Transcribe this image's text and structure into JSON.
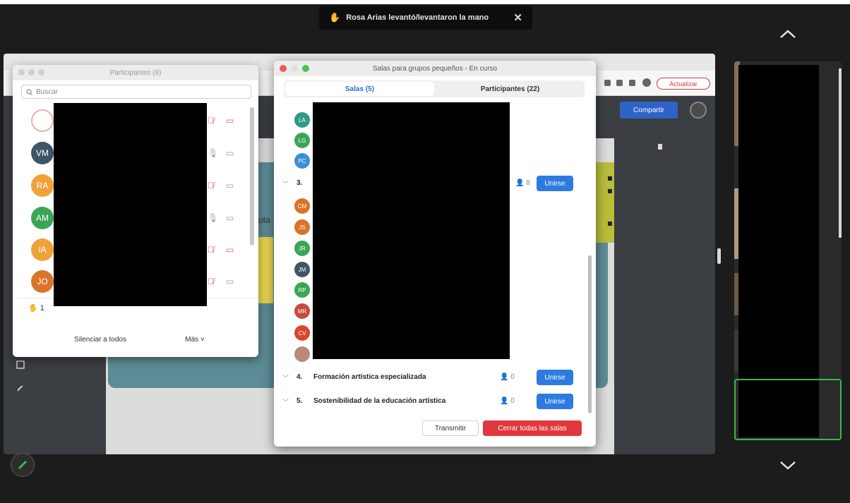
{
  "notification": {
    "text": "Rosa Arias levantó/levantaron la mano",
    "close_label": "✕"
  },
  "shared_screen": {
    "share_label": "Compartir",
    "update_label": "Actualizar",
    "doc_fragment": "ota"
  },
  "participants_window": {
    "title": "Participantes (8)",
    "search_placeholder": "Buscar",
    "participants": [
      {
        "initials": "",
        "color": "#ffffff",
        "mic": "muted",
        "camera": "off"
      },
      {
        "initials": "VM",
        "color": "#3f5566",
        "mic": "on",
        "camera": "on"
      },
      {
        "initials": "RA",
        "color": "#f0a23a",
        "mic": "muted",
        "camera": "on"
      },
      {
        "initials": "AM",
        "color": "#3aa655",
        "mic": "on",
        "camera": "on"
      },
      {
        "initials": "IA",
        "color": "#f0a23a",
        "mic": "muted",
        "camera": "off"
      },
      {
        "initials": "JO",
        "color": "#d9742a",
        "mic": "muted",
        "camera": "on"
      }
    ],
    "raised_hands": "1",
    "mute_all_label": "Silenciar a todos",
    "more_label": "Más ˅"
  },
  "breakout_window": {
    "title": "Salas para grupos pequeños - En curso",
    "tabs": [
      {
        "label": "Salas (5)",
        "active": true
      },
      {
        "label": "Participantes (22)",
        "active": false
      }
    ],
    "room2_members": [
      {
        "initials": "LA",
        "color": "#2e9b8a"
      },
      {
        "initials": "LG",
        "color": "#3aa655"
      },
      {
        "initials": "PC",
        "color": "#3b8fd6"
      }
    ],
    "room3": {
      "number": "3.",
      "count": "8",
      "join_label": "Unirse"
    },
    "room3_members": [
      {
        "initials": "CM",
        "color": "#d9742a"
      },
      {
        "initials": "JS",
        "color": "#d9742a"
      },
      {
        "initials": "JR",
        "color": "#3aa655"
      },
      {
        "initials": "JM",
        "color": "#3f5566"
      },
      {
        "initials": "RP",
        "color": "#3aa655"
      },
      {
        "initials": "MR",
        "color": "#c84b3e"
      },
      {
        "initials": "CV",
        "color": "#d9452e"
      },
      {
        "initials": "",
        "color": "#b88a7a"
      }
    ],
    "rooms": [
      {
        "number": "4.",
        "name": "Formación artística especializada",
        "count": "0",
        "join_label": "Unirse"
      },
      {
        "number": "5.",
        "name": "Sostenibilidad de la educación artística",
        "count": "0",
        "join_label": "Unirse"
      }
    ],
    "transmit_label": "Transmitir",
    "close_all_label": "Cerrar todas las salas"
  },
  "colors": {
    "zoom_blue": "#2d7be0",
    "close_red": "#e0383e",
    "active_speaker_green": "#3fb64c"
  }
}
